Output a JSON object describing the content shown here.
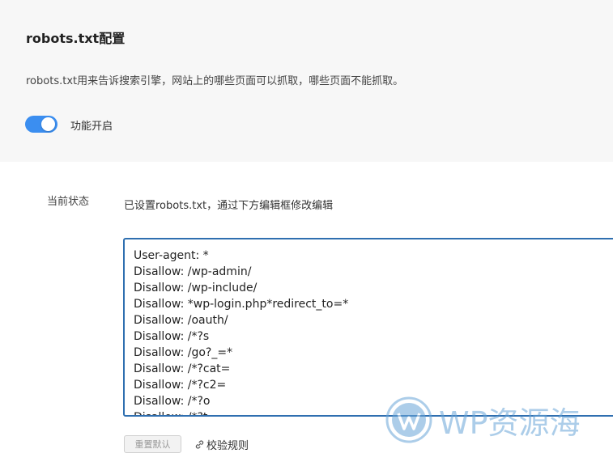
{
  "header": {
    "title": "robots.txt配置",
    "description": "robots.txt用来告诉搜索引擎，网站上的哪些页面可以抓取，哪些页面不能抓取。",
    "toggle_label": "功能开启",
    "toggle_on": true,
    "accent_color": "#3b8ef0"
  },
  "status": {
    "label": "当前状态",
    "text": "已设置robots.txt，通过下方编辑框修改编辑"
  },
  "editor": {
    "lines": [
      "User-agent: *",
      "Disallow: /wp-admin/",
      "Disallow: /wp-include/",
      "Disallow: *wp-login.php*redirect_to=*",
      "Disallow: /oauth/",
      "Disallow: /*?s",
      "Disallow: /go?_=*",
      "Disallow: /*?cat=",
      "Disallow: /*?c2=",
      "Disallow: /*?o",
      "Disallow: /*?t"
    ]
  },
  "actions": {
    "reset_label": "重置默认",
    "validate_label": "校验规则",
    "validate_icon": "link-icon"
  },
  "watermark": {
    "text": "WP资源海",
    "logo_icon": "wordpress-logo"
  }
}
